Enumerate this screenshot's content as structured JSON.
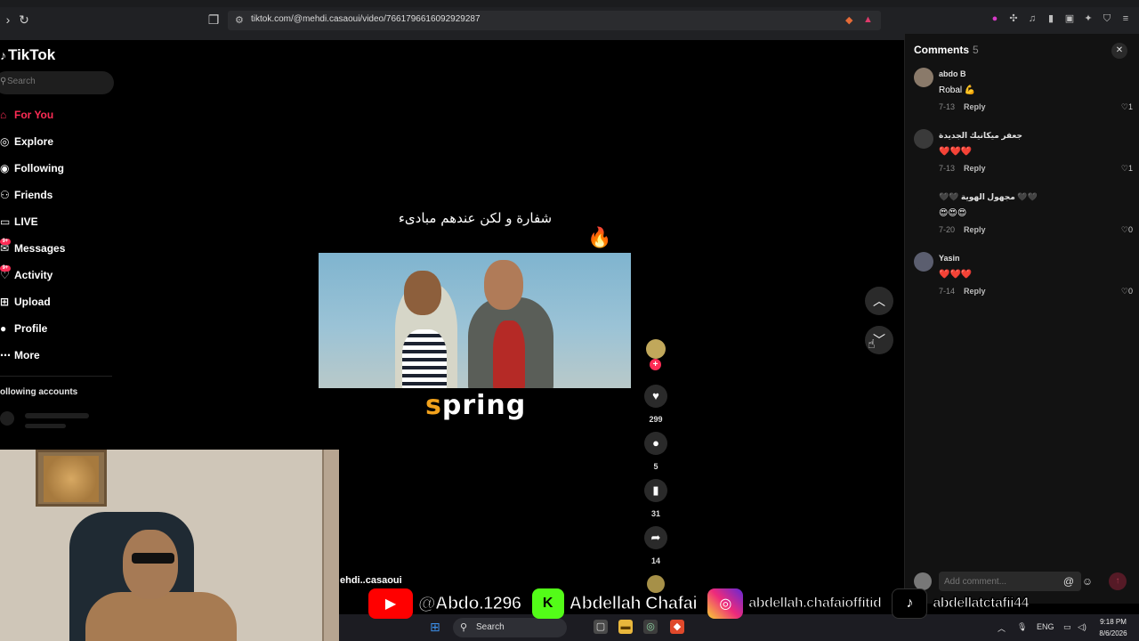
{
  "browser": {
    "url": "tiktok.com/@mehdi.casaoui/video/7661796616092929287",
    "back_icon": "chevron-right-icon",
    "reload_icon": "reload-icon"
  },
  "sidebar": {
    "logo": "TikTok",
    "search_placeholder": "Search",
    "items": [
      {
        "label": "For You",
        "icon": "home-icon",
        "active": true
      },
      {
        "label": "Explore",
        "icon": "compass-icon"
      },
      {
        "label": "Following",
        "icon": "following-icon"
      },
      {
        "label": "Friends",
        "icon": "friends-icon"
      },
      {
        "label": "LIVE",
        "icon": "live-icon"
      },
      {
        "label": "Messages",
        "icon": "messages-icon",
        "badge": "9+"
      },
      {
        "label": "Activity",
        "icon": "activity-icon",
        "badge": "9+"
      },
      {
        "label": "Upload",
        "icon": "upload-icon"
      },
      {
        "label": "Profile",
        "icon": "profile-icon"
      },
      {
        "label": "More",
        "icon": "more-icon"
      }
    ],
    "following_accounts": "ollowing accounts"
  },
  "video": {
    "caption_top": "شفارة و لكن عندهم مبادىء",
    "watermark": "spring",
    "author": "ehdi..casaoui",
    "likes": "299",
    "comments": "5",
    "saves": "31",
    "shares": "14"
  },
  "comments": {
    "title": "Comments",
    "count": "5",
    "items": [
      {
        "user": "abdo B",
        "text": "Robal 💪",
        "date": "7-13",
        "reply": "Reply",
        "likes": "1"
      },
      {
        "user": "جعفر ميكانيك الجديدة",
        "text": "❤️❤️❤️",
        "date": "7-13",
        "reply": "Reply",
        "likes": "1"
      },
      {
        "user": "🖤🖤 مجهول الهوية 🖤🖤",
        "text": "😍😍😍",
        "date": "7-20",
        "reply": "Reply",
        "likes": "0"
      },
      {
        "user": "Yasin",
        "text": "❤️❤️❤️",
        "date": "7-14",
        "reply": "Reply",
        "likes": "0"
      }
    ],
    "input_placeholder": "Add comment..."
  },
  "overlay": {
    "youtube": "@Abdo.1296",
    "kick": "Abdellah Chafai",
    "instagram": "abdellah.chafaioffitid",
    "tiktok": "abdellatctafii44"
  },
  "taskbar": {
    "search": "Search",
    "lang": "ENG",
    "time": "9:18 PM",
    "date": "8/6/2026"
  },
  "colors": {
    "accent": "#fe2c55",
    "background": "#000000",
    "panel": "#121212"
  }
}
